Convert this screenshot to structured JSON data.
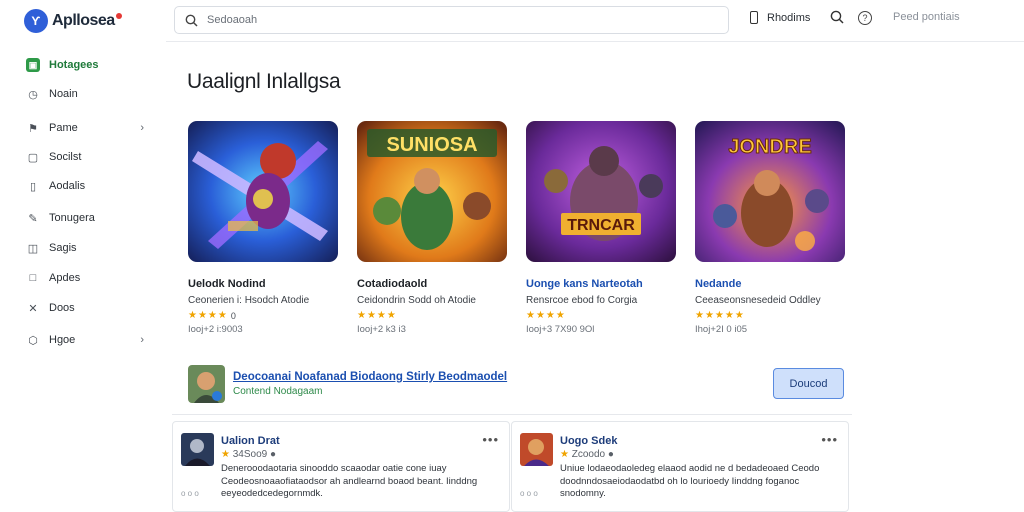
{
  "brand": {
    "logo_text": "Ƴ",
    "name": "Apllosea"
  },
  "sidebar": {
    "items": [
      {
        "label": "Hotagees",
        "icon": "store-icon",
        "glyph": "▣",
        "active": true
      },
      {
        "label": "Noain",
        "icon": "clock-icon",
        "glyph": "◷"
      },
      {
        "label": "Pame",
        "icon": "flag-icon",
        "glyph": "⚑",
        "chevron": "›"
      },
      {
        "label": "Socilst",
        "icon": "chat-icon",
        "glyph": "▢"
      },
      {
        "label": "Aodalis",
        "icon": "document-icon",
        "glyph": "▯"
      },
      {
        "label": "Tonugera",
        "icon": "pen-icon",
        "glyph": "✎"
      },
      {
        "label": "Sagis",
        "icon": "bag-icon",
        "glyph": "◫"
      },
      {
        "label": "Apdes",
        "icon": "box-icon",
        "glyph": "□"
      },
      {
        "label": "Doos",
        "icon": "tools-icon",
        "glyph": "✕"
      },
      {
        "label": "Hgoe",
        "icon": "shield-icon",
        "glyph": "⬡",
        "chevron": "›"
      }
    ]
  },
  "topbar": {
    "search_placeholder": "Sedoaoah",
    "phone_label": "Rhodims",
    "link_label": "Peed pontiais"
  },
  "main": {
    "title": "Uaalignl Inlallgsa",
    "cards": [
      {
        "title": "Uelodk Nodind",
        "subtitle": "Ceonerien i: Hsodch Atodie",
        "stars": "★★★★",
        "rating": "0",
        "meta": "Iooj+2 i:9003"
      },
      {
        "title": "Cotadiodaold",
        "subtitle": "Ceidondrin Sodd oh Atodie",
        "stars": "★★★★",
        "rating": "",
        "meta": "Iooj+2 k3 i3"
      },
      {
        "title": "Uonge kans Narteotah",
        "subtitle": "Rensrcoe ebod fo Corgia",
        "stars": "★★★★",
        "rating": "",
        "meta": "Iooj+3 7X90 9Ol"
      },
      {
        "title": "Nedande",
        "subtitle": "Ceeaseonsnesedeid Oddley",
        "stars": "★★★★★",
        "rating": "",
        "meta": "Ihoj+2I 0 i05"
      }
    ],
    "promo": {
      "title": "Deocoanai Noafanad Biodaong Stirly Beodmaodel",
      "subtitle": "Contend Nodagaam",
      "button": "Doucod"
    },
    "reviews": [
      {
        "name": "Ualion Drat",
        "stars": "★",
        "score": "34Soo9 ●",
        "more": "•••",
        "text": "Denerooodaotaria sinooddo scaaodar oatie cone iuay Ceodeosnoaaofiataodsor ah andlearnd boaod beant. Iinddng eeyeodedcedegornmdk.",
        "time": "o o o"
      },
      {
        "name": "Uogo Sdek",
        "stars": "★",
        "score": "Zcoodo ●",
        "more": "•••",
        "text": "Uniue lodaeodaoledeg elaaod aodid ne d bedadeoaed Ceodo doodnndosaeiodaodatbd oh lo lourioedy Iinddng foganoc snodomny.",
        "time": "o o o"
      }
    ]
  },
  "colors": {
    "accent": "#2f5fd8",
    "active_nav": "#2e9a48",
    "link": "#1b4fb0",
    "star": "#f0a400"
  }
}
